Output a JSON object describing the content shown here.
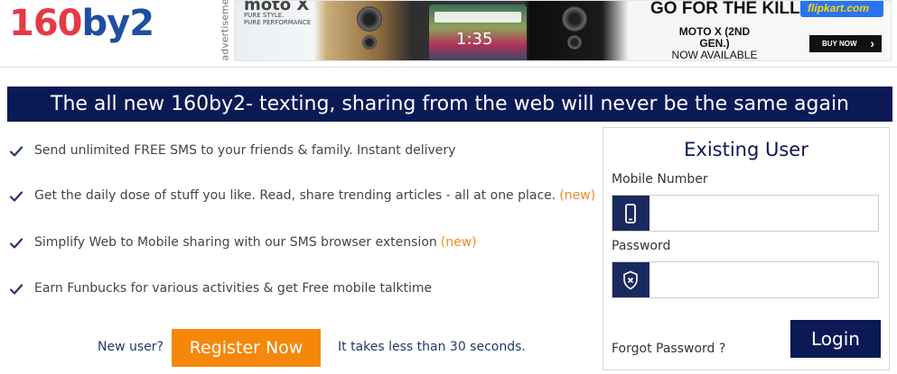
{
  "header": {
    "logo_part1": "160",
    "logo_part2": "by2",
    "ad_label": "advertisement",
    "ad": {
      "brand": "moto X",
      "brand_sub1": "PURE STYLE.",
      "brand_sub2": "PURE PERFORMANCE",
      "screen_time": "1:35",
      "headline": "GO FOR THE KILL",
      "retailer": "flipkart.com",
      "model_line1": "MOTO X (2ND GEN.)",
      "model_line2": "NOW AVAILABLE",
      "cta": "BUY NOW"
    }
  },
  "banner": {
    "text": "The all new 160by2- texting, sharing from the web will never be the same again"
  },
  "features": [
    {
      "text": "Send unlimited FREE SMS to your friends & family. Instant delivery",
      "badge": ""
    },
    {
      "text": "Get the daily dose of stuff you like. Read, share trending articles - all at one place.",
      "badge": "(new)"
    },
    {
      "text": "Simplify Web to Mobile sharing with our SMS browser extension",
      "badge": "(new)"
    },
    {
      "text": "Earn Funbucks for various activities & get Free mobile talktime",
      "badge": ""
    }
  ],
  "register": {
    "prompt": "New user?",
    "button": "Register Now",
    "note": "It takes less than 30 seconds."
  },
  "login": {
    "title": "Existing User",
    "mobile_label": "Mobile Number",
    "mobile_value": "",
    "password_label": "Password",
    "password_value": "",
    "forgot": "Forgot Password ?",
    "button": "Login"
  },
  "colors": {
    "navy": "#0b1a55",
    "orange": "#f5870a",
    "badge_orange": "#f08a24",
    "logo_red": "#e63946",
    "logo_blue": "#1f4f9e"
  }
}
